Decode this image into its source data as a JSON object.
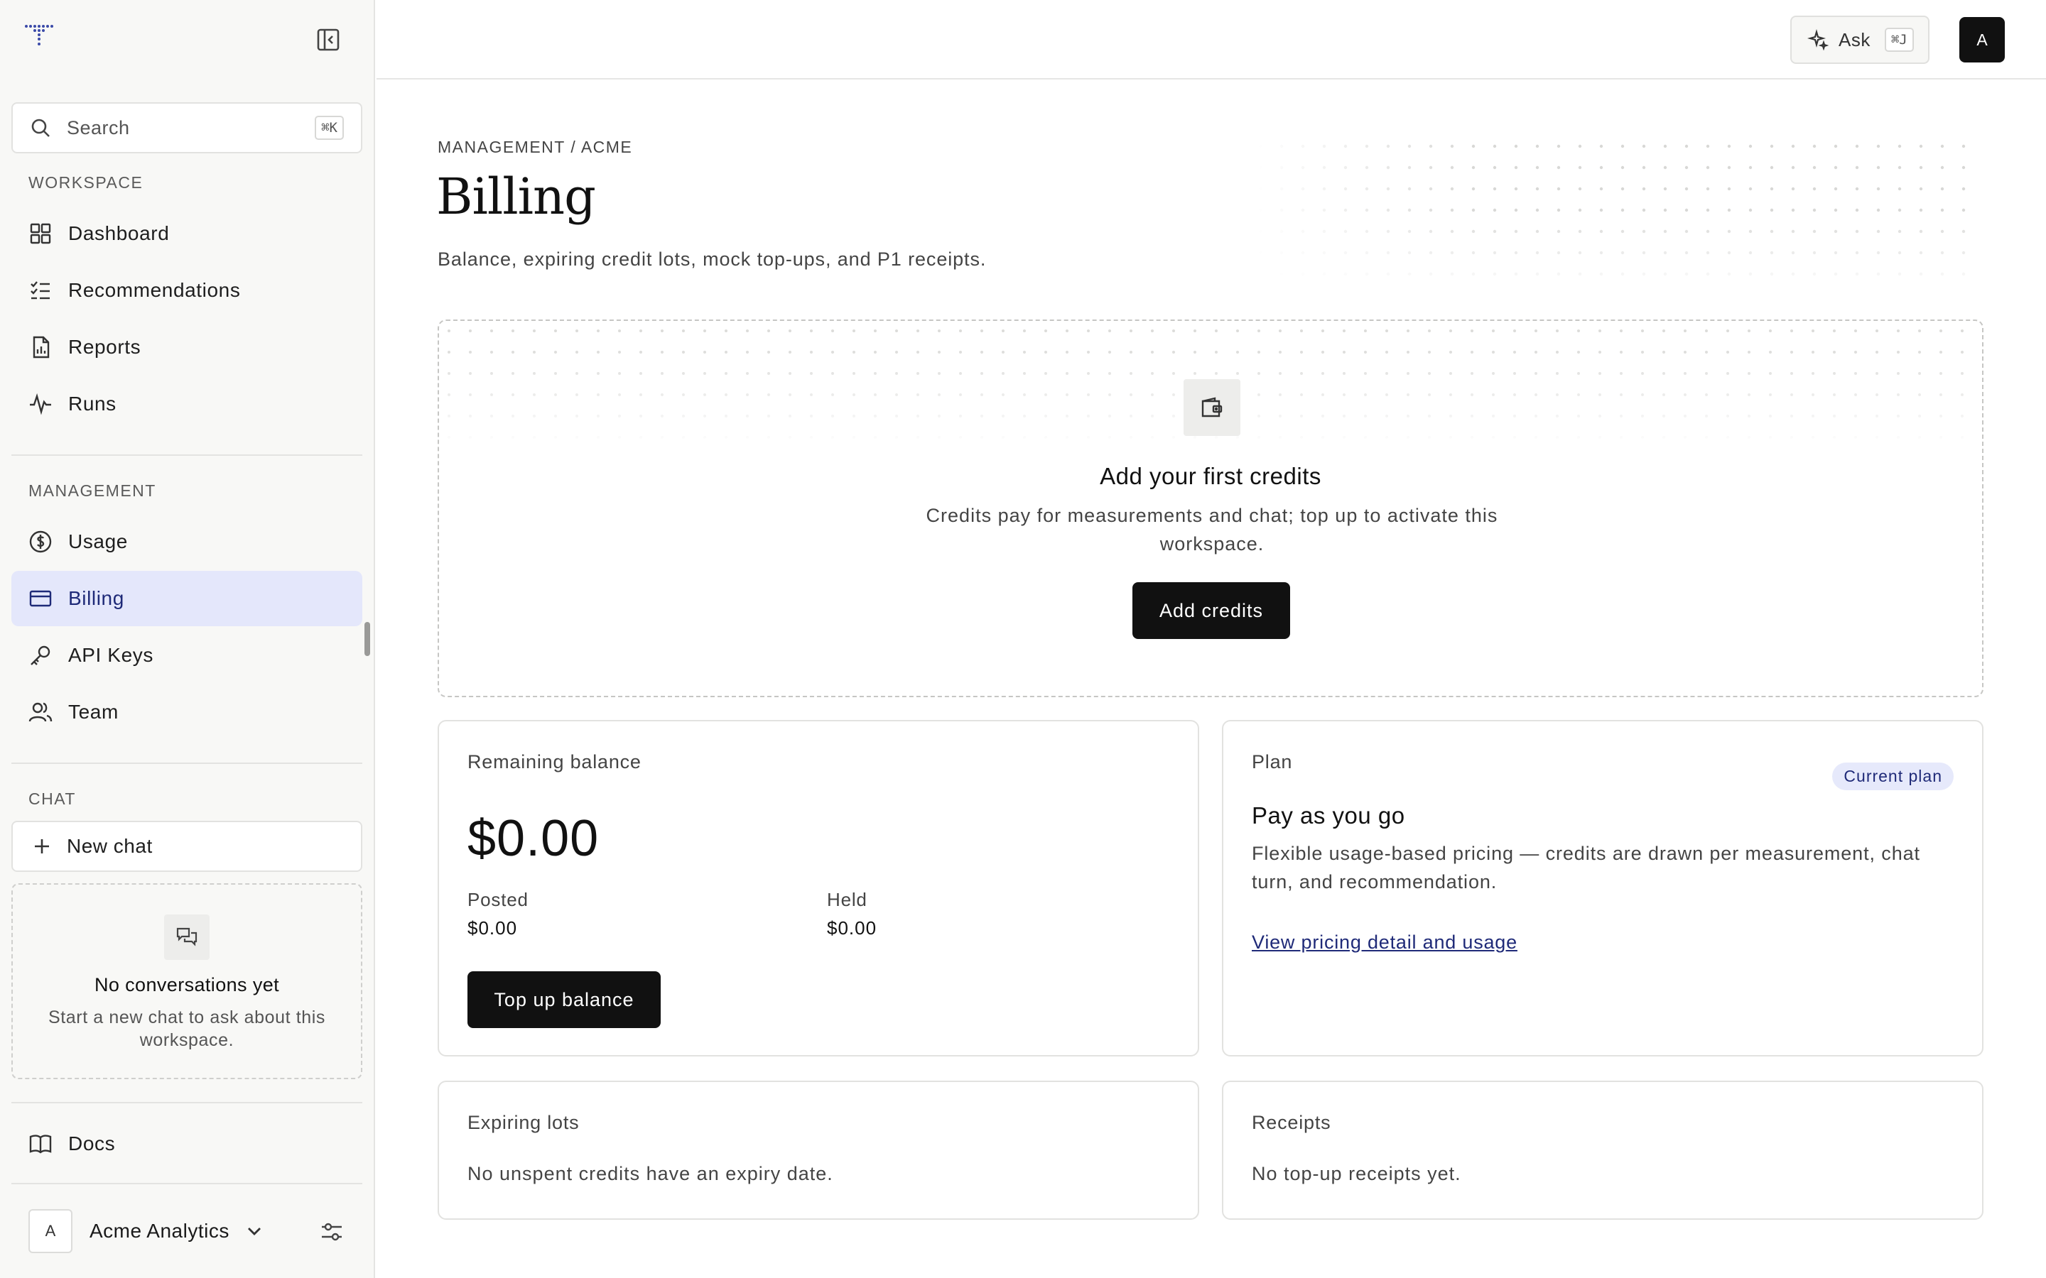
{
  "sidebar": {
    "search": {
      "label": "Search",
      "shortcut": "⌘K"
    },
    "sections": {
      "workspace": "WORKSPACE",
      "management": "MANAGEMENT",
      "chat": "CHAT"
    },
    "workspace_items": [
      {
        "label": "Dashboard",
        "icon": "dashboard-icon"
      },
      {
        "label": "Recommendations",
        "icon": "checklist-icon"
      },
      {
        "label": "Reports",
        "icon": "report-icon"
      },
      {
        "label": "Runs",
        "icon": "activity-icon"
      }
    ],
    "management_items": [
      {
        "label": "Usage",
        "icon": "dollar-icon"
      },
      {
        "label": "Billing",
        "icon": "credit-card-icon",
        "active": true
      },
      {
        "label": "API Keys",
        "icon": "key-icon"
      },
      {
        "label": "Team",
        "icon": "users-icon"
      }
    ],
    "new_chat_label": "New chat",
    "empty_chat": {
      "title": "No conversations yet",
      "description": "Start a new chat to ask about this workspace."
    },
    "docs_label": "Docs",
    "org": {
      "avatar": "A",
      "name": "Acme Analytics"
    }
  },
  "topbar": {
    "ask_label": "Ask",
    "ask_shortcut": "⌘J",
    "user_avatar": "A"
  },
  "page": {
    "breadcrumb": "MANAGEMENT / ACME",
    "title": "Billing",
    "subtitle": "Balance, expiring credit lots, mock top-ups, and P1 receipts."
  },
  "hero": {
    "title": "Add your first credits",
    "description": "Credits pay for measurements and chat; top up to activate this workspace.",
    "button": "Add credits"
  },
  "balance_card": {
    "label": "Remaining balance",
    "amount": "$0.00",
    "posted_label": "Posted",
    "posted_value": "$0.00",
    "held_label": "Held",
    "held_value": "$0.00",
    "button": "Top up balance"
  },
  "plan_card": {
    "label": "Plan",
    "badge": "Current plan",
    "name": "Pay as you go",
    "description": "Flexible usage-based pricing — credits are drawn per measurement, chat turn, and recommendation.",
    "link": "View pricing detail and usage"
  },
  "expiring_card": {
    "label": "Expiring lots",
    "empty_text": "No unspent credits have an expiry date."
  },
  "receipts_card": {
    "label": "Receipts",
    "empty_text": "No top-up receipts yet."
  },
  "colors": {
    "accent": "#1f2a78",
    "active_bg": "#e4e7fb",
    "primary_button": "#111111"
  }
}
